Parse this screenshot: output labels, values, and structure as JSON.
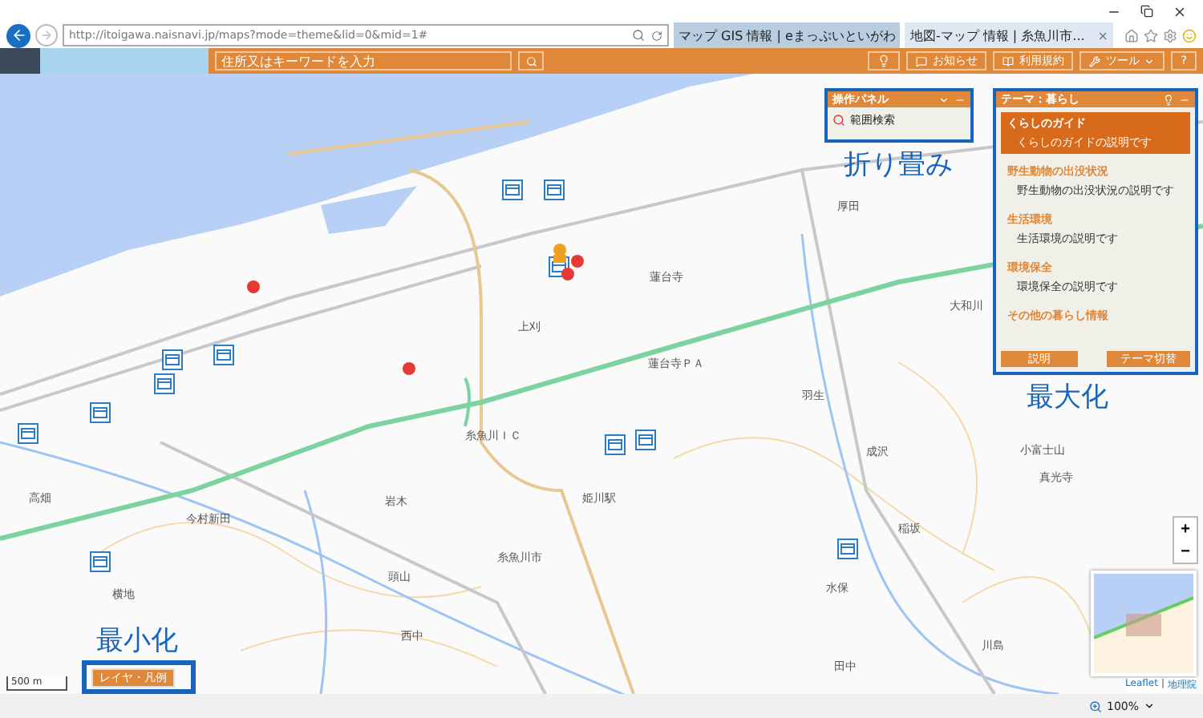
{
  "browser": {
    "url": "http://itoigawa.naisnavi.jp/maps?mode=theme&lid=0&mid=1#",
    "tabs": [
      {
        "title": "マップ GIS 情報 | eまっぷいといがわ",
        "selected": false
      },
      {
        "title": "地図-マップ 情報 | 糸魚川市...",
        "selected": true
      }
    ],
    "tab_close": "×"
  },
  "toolbar": {
    "search": {
      "placeholder": "住所又はキーワードを入力"
    },
    "buttons": [
      {
        "kind": "pin"
      },
      {
        "kind": "news",
        "label": "お知らせ"
      },
      {
        "kind": "book",
        "label": "利用規約"
      },
      {
        "kind": "tool",
        "label": "ツール"
      },
      {
        "kind": "help",
        "label": "?"
      }
    ]
  },
  "operation_panel": {
    "title": "操作パネル",
    "items": [
      "範囲検索"
    ]
  },
  "theme_panel": {
    "title": "テーマ：暮らし",
    "items": [
      {
        "name": "くらしのガイド",
        "description": "くらしのガイドの説明です",
        "selected": true
      },
      {
        "name": "野生動物の出没状況",
        "description": "野生動物の出没状況の説明です",
        "selected": false
      },
      {
        "name": "生活環境",
        "description": "生活環境の説明です",
        "selected": false
      },
      {
        "name": "環境保全",
        "description": "環境保全の説明です",
        "selected": false
      },
      {
        "name": "その他の暮らし情報",
        "selected": false
      }
    ],
    "buttons": [
      "説明",
      "テーマ切替"
    ]
  },
  "annotations": [
    "折り畳み",
    "最大化",
    "最小化"
  ],
  "map_labels": [
    "蓮台寺",
    "上刈",
    "蓮台寺ＰＡ",
    "羽生",
    "糸魚川ＩＣ",
    "岩木",
    "姫川駅",
    "糸魚川市",
    "頭山",
    "西中",
    "水保",
    "田中",
    "成沢",
    "小富士山",
    "真光寺",
    "稲坂",
    "川島",
    "大和川",
    "厚田",
    "横地",
    "今村新田",
    "高畑"
  ],
  "layer_button": "レイヤ・凡例",
  "scale": "500 m",
  "zoom": [
    "+",
    "−"
  ],
  "attribution": {
    "link": "Leaflet",
    "separator": "|",
    "source": "地理院"
  },
  "status_bar": {
    "zoom": "100%"
  }
}
